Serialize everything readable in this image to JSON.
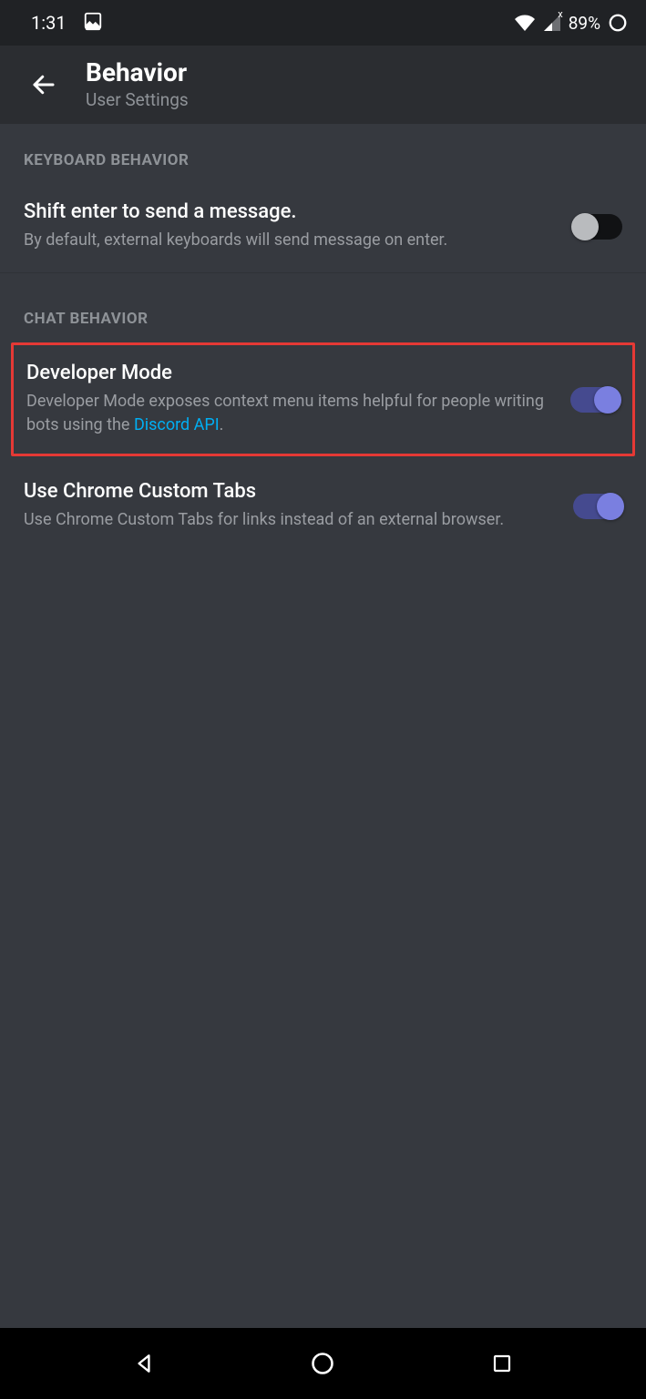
{
  "status": {
    "time": "1:31",
    "battery": "89%",
    "signal_overlay": "x"
  },
  "header": {
    "title": "Behavior",
    "subtitle": "User Settings"
  },
  "sections": {
    "keyboard": {
      "label": "KEYBOARD BEHAVIOR",
      "shift_enter": {
        "title": "Shift enter to send a message.",
        "desc": "By default, external keyboards will send message on enter."
      }
    },
    "chat": {
      "label": "CHAT BEHAVIOR",
      "dev_mode": {
        "title": "Developer Mode",
        "desc_pre": "Developer Mode exposes context menu items helpful for people writing bots using the ",
        "link": "Discord API",
        "desc_post": "."
      },
      "chrome_tabs": {
        "title": "Use Chrome Custom Tabs",
        "desc": "Use Chrome Custom Tabs for links instead of an external browser."
      }
    }
  }
}
